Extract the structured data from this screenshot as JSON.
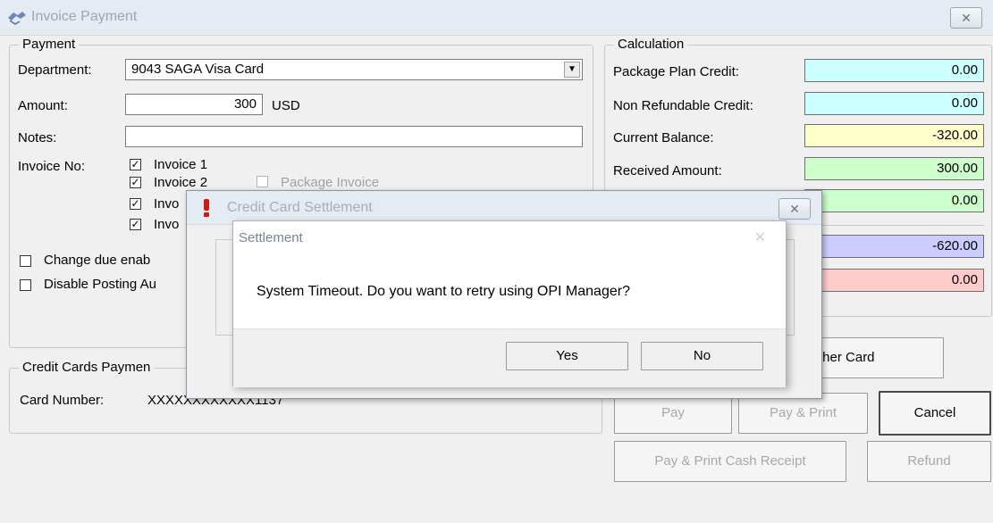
{
  "window": {
    "title": "Invoice Payment",
    "close_glyph": "✕"
  },
  "payment": {
    "legend": "Payment",
    "department_label": "Department:",
    "department_value": "9043  SAGA Visa Card",
    "amount_label": "Amount:",
    "amount_value": "300",
    "currency": "USD",
    "notes_label": "Notes:",
    "notes_value": "",
    "invoice_label": "Invoice No:",
    "invoices": [
      {
        "label": "Invoice 1",
        "checked": true
      },
      {
        "label": "Invoice 2",
        "checked": true
      },
      {
        "label": "Invo",
        "checked": true
      },
      {
        "label": "Invo",
        "checked": true
      }
    ],
    "package_invoice_label": "Package Invoice",
    "change_due_label": "Change due enab",
    "disable_posting_label": "Disable Posting Au"
  },
  "credit_cards": {
    "legend": "Credit Cards Paymen",
    "card_number_label": "Card Number:",
    "card_number_value": "XXXXXXXXXXXX1137"
  },
  "calculation": {
    "legend": "Calculation",
    "rows": [
      {
        "label": "Package Plan Credit:",
        "value": "0.00",
        "color": "#ccffff"
      },
      {
        "label": "Non Refundable Credit:",
        "value": "0.00",
        "color": "#ccffff"
      },
      {
        "label": "Current Balance:",
        "value": "-320.00",
        "color": "#ffffcc"
      },
      {
        "label": "Received Amount:",
        "value": "300.00",
        "color": "#ccffcc"
      },
      {
        "label": "",
        "value": "0.00",
        "color": "#ccffcc"
      },
      {
        "label": "",
        "value": "-620.00",
        "color": "#ccccff"
      },
      {
        "label": "",
        "value": "0.00",
        "color": "#ffcccc"
      }
    ]
  },
  "buttons": {
    "other_card": "ther Card",
    "pay": "Pay",
    "pay_print": "Pay & Print",
    "cancel": "Cancel",
    "pay_print_cash": "Pay & Print Cash Receipt",
    "refund": "Refund"
  },
  "ccs_dialog": {
    "title": "Credit Card Settlement",
    "close_glyph": "✕"
  },
  "settlement": {
    "title": "Settlement",
    "close_glyph": "✕",
    "message": "System Timeout. Do you want to retry using OPI Manager?",
    "yes": "Yes",
    "no": "No"
  }
}
